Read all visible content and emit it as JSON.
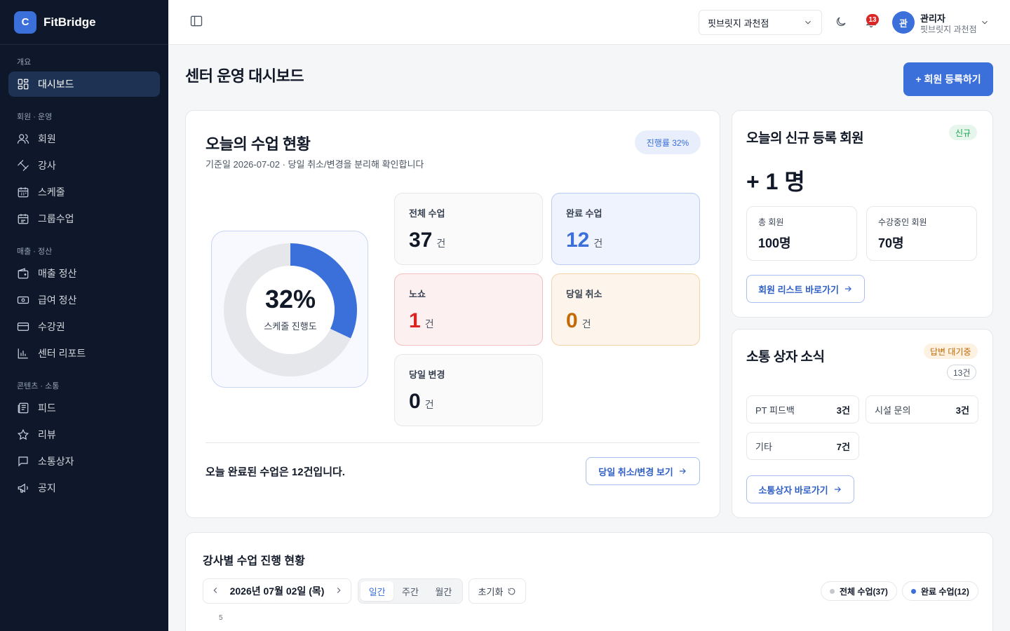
{
  "brand": {
    "logo_letter": "C",
    "name": "FitBridge"
  },
  "sidebar": {
    "sections": [
      {
        "label": "개요",
        "items": [
          {
            "label": "대시보드",
            "icon": "grid-icon",
            "active": true
          }
        ]
      },
      {
        "label": "회원 · 운영",
        "items": [
          {
            "label": "회원",
            "icon": "users-icon"
          },
          {
            "label": "강사",
            "icon": "dumbbell-icon"
          },
          {
            "label": "스케줄",
            "icon": "calendar-icon"
          },
          {
            "label": "그룹수업",
            "icon": "calendar-check-icon"
          }
        ]
      },
      {
        "label": "매출 · 정산",
        "items": [
          {
            "label": "매출 정산",
            "icon": "wallet-icon"
          },
          {
            "label": "급여 정산",
            "icon": "banknote-icon"
          },
          {
            "label": "수강권",
            "icon": "card-icon"
          },
          {
            "label": "센터 리포트",
            "icon": "bar-chart-icon"
          }
        ]
      },
      {
        "label": "콘텐츠 · 소통",
        "items": [
          {
            "label": "피드",
            "icon": "newspaper-icon"
          },
          {
            "label": "리뷰",
            "icon": "star-icon"
          },
          {
            "label": "소통상자",
            "icon": "message-icon"
          },
          {
            "label": "공지",
            "icon": "megaphone-icon"
          }
        ]
      }
    ]
  },
  "topbar": {
    "branch": "핏브릿지 과천점",
    "notification_count": "13",
    "user": {
      "avatar_letter": "관",
      "name": "관리자",
      "branch": "핏브릿지 과천점"
    }
  },
  "page": {
    "title": "센터 운영 대시보드",
    "register_button": "+ 회원 등록하기"
  },
  "today_classes": {
    "title": "오늘의 수업 현황",
    "subtitle": "기준일 2026-07-02 · 당일 취소/변경을 분리해 확인합니다",
    "progress_pill": "진행률 32%",
    "donut": {
      "percent_text": "32%",
      "progress": 0.32,
      "label": "스케줄 진행도"
    },
    "stats": {
      "total": {
        "label": "전체 수업",
        "value": "37",
        "unit": "건"
      },
      "completed": {
        "label": "완료 수업",
        "value": "12",
        "unit": "건"
      },
      "noshow": {
        "label": "노쇼",
        "value": "1",
        "unit": "건"
      },
      "cancel": {
        "label": "당일 취소",
        "value": "0",
        "unit": "건"
      },
      "change": {
        "label": "당일 변경",
        "value": "0",
        "unit": "건"
      }
    },
    "summary": "오늘 완료된 수업은 12건입니다.",
    "link_button": "당일 취소/변경 보기"
  },
  "new_members": {
    "title": "오늘의 신규 등록 회원",
    "tag": "신규",
    "count": "+ 1 명",
    "total": {
      "label": "총 회원",
      "value": "100명"
    },
    "active": {
      "label": "수강중인 회원",
      "value": "70명"
    },
    "link_button": "회원 리스트 바로가기"
  },
  "messages": {
    "title": "소통 상자 소식",
    "tag_status": "답변 대기중",
    "tag_count": "13건",
    "categories": [
      {
        "label": "PT 피드백",
        "value": "3건"
      },
      {
        "label": "시설 문의",
        "value": "3건"
      },
      {
        "label": "기타",
        "value": "7건"
      }
    ],
    "link_button": "소통상자 바로가기"
  },
  "trainer_progress": {
    "title": "강사별 수업 진행 현황",
    "date": "2026년 07월 02일 (목)",
    "periods": [
      "일간",
      "주간",
      "월간"
    ],
    "active_period": "일간",
    "reset": "초기화",
    "legend": [
      {
        "label": "전체 수업(37)",
        "color": "#c4c7cc"
      },
      {
        "label": "완료 수업(12)",
        "color": "#3b6fd9"
      }
    ],
    "y_tick_top": "5"
  },
  "colors": {
    "accent": "#3b6fd9",
    "sidebar_bg": "#0f172a",
    "danger": "#dc2626",
    "warning": "#c26a05",
    "success": "#16a34a"
  }
}
